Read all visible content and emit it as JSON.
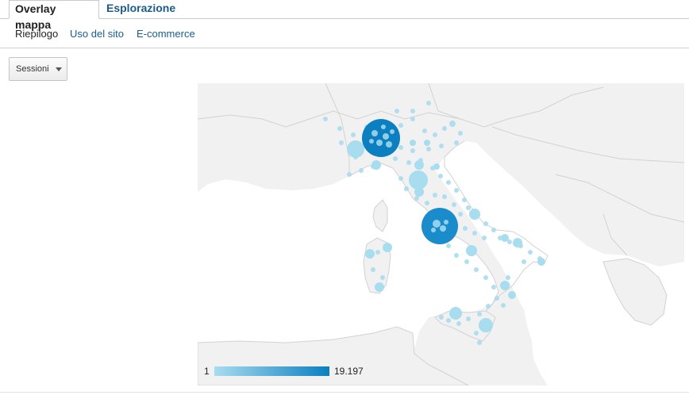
{
  "tabs": [
    {
      "label": "Overlay mappa",
      "active": true
    },
    {
      "label": "Esplorazione",
      "active": false
    }
  ],
  "subnav": [
    {
      "label": "Riepilogo",
      "active": true
    },
    {
      "label": "Uso del sito",
      "active": false
    },
    {
      "label": "E-commerce",
      "active": false
    }
  ],
  "metric_dropdown": {
    "selected": "Sessioni"
  },
  "map": {
    "region": "Italy",
    "land_color": "#f1f1f1",
    "sea_color": "#ffffff",
    "border_color": "#d2d2d2",
    "bubble_color_min": "#a8dcef",
    "bubble_color_max": "#0b7fc0",
    "legend": {
      "min": "1",
      "max": "19.197"
    }
  }
}
